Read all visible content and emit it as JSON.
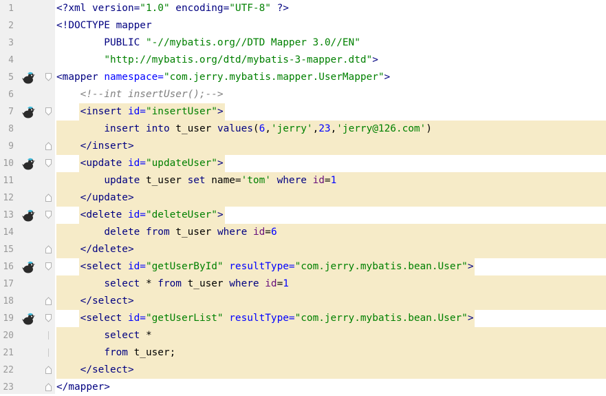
{
  "editor": {
    "lines": [
      {
        "n": "1",
        "tokens": [
          {
            "t": "<?xml version=",
            "c": "t-prolog"
          },
          {
            "t": "\"1.0\"",
            "c": "t-str"
          },
          {
            "t": " encoding=",
            "c": "t-prolog"
          },
          {
            "t": "\"UTF-8\"",
            "c": "t-str"
          },
          {
            "t": " ?>",
            "c": "t-prolog"
          }
        ]
      },
      {
        "n": "2",
        "tokens": [
          {
            "t": "<!DOCTYPE mapper",
            "c": "t-tag"
          }
        ]
      },
      {
        "n": "3",
        "tokens": [
          {
            "t": "        PUBLIC ",
            "c": "t-tag"
          },
          {
            "t": "\"-//mybatis.org//DTD Mapper 3.0//EN\"",
            "c": "t-str"
          }
        ]
      },
      {
        "n": "4",
        "tokens": [
          {
            "t": "        ",
            "c": "t-plain"
          },
          {
            "t": "\"http://mybatis.org/dtd/mybatis-3-mapper.dtd\"",
            "c": "t-str"
          },
          {
            "t": ">",
            "c": "t-tag"
          }
        ]
      },
      {
        "n": "5",
        "icon": true,
        "fold": "open",
        "tokens": [
          {
            "t": "<mapper ",
            "c": "t-tag"
          },
          {
            "t": "namespace=",
            "c": "t-attr"
          },
          {
            "t": "\"com.jerry.mybatis.mapper.UserMapper\"",
            "c": "t-str"
          },
          {
            "t": ">",
            "c": "t-tag"
          }
        ]
      },
      {
        "n": "6",
        "tokens": [
          {
            "t": "    ",
            "c": "t-plain"
          },
          {
            "t": "<!--int insertUser();-->",
            "c": "t-comment"
          }
        ]
      },
      {
        "n": "7",
        "icon": true,
        "fold": "open",
        "hl": "tag",
        "tokens": [
          {
            "t": "    ",
            "c": "t-plain"
          },
          {
            "t": "<insert ",
            "c": "t-tag"
          },
          {
            "t": "id=",
            "c": "t-attr"
          },
          {
            "t": "\"insertUser\"",
            "c": "t-str"
          },
          {
            "t": ">",
            "c": "t-tag"
          }
        ]
      },
      {
        "n": "8",
        "hl": "full",
        "tokens": [
          {
            "t": "        ",
            "c": "t-plain"
          },
          {
            "t": "insert into",
            "c": "t-kw"
          },
          {
            "t": " t_user ",
            "c": "t-plain"
          },
          {
            "t": "values",
            "c": "t-kw"
          },
          {
            "t": "(",
            "c": "t-plain"
          },
          {
            "t": "6",
            "c": "t-num"
          },
          {
            "t": ",",
            "c": "t-plain"
          },
          {
            "t": "'jerry'",
            "c": "t-sql-str"
          },
          {
            "t": ",",
            "c": "t-plain"
          },
          {
            "t": "23",
            "c": "t-num"
          },
          {
            "t": ",",
            "c": "t-plain"
          },
          {
            "t": "'jerry@126.com'",
            "c": "t-sql-str"
          },
          {
            "t": ")",
            "c": "t-plain"
          }
        ]
      },
      {
        "n": "9",
        "fold": "close",
        "hl": "full",
        "tokens": [
          {
            "t": "    ",
            "c": "t-plain"
          },
          {
            "t": "</insert>",
            "c": "t-tag"
          }
        ]
      },
      {
        "n": "10",
        "icon": true,
        "fold": "open",
        "hl": "tag",
        "tokens": [
          {
            "t": "    ",
            "c": "t-plain"
          },
          {
            "t": "<update ",
            "c": "t-tag"
          },
          {
            "t": "id=",
            "c": "t-attr"
          },
          {
            "t": "\"updateUser\"",
            "c": "t-str"
          },
          {
            "t": ">",
            "c": "t-tag"
          }
        ]
      },
      {
        "n": "11",
        "hl": "full",
        "tokens": [
          {
            "t": "        ",
            "c": "t-plain"
          },
          {
            "t": "update",
            "c": "t-kw"
          },
          {
            "t": " t_user ",
            "c": "t-plain"
          },
          {
            "t": "set",
            "c": "t-kw"
          },
          {
            "t": " name=",
            "c": "t-plain"
          },
          {
            "t": "'tom'",
            "c": "t-sql-str"
          },
          {
            "t": " ",
            "c": "t-plain"
          },
          {
            "t": "where",
            "c": "t-kw"
          },
          {
            "t": " ",
            "c": "t-plain"
          },
          {
            "t": "id",
            "c": "t-id"
          },
          {
            "t": "=",
            "c": "t-plain"
          },
          {
            "t": "1",
            "c": "t-num"
          }
        ]
      },
      {
        "n": "12",
        "fold": "close",
        "hl": "full",
        "tokens": [
          {
            "t": "    ",
            "c": "t-plain"
          },
          {
            "t": "</update>",
            "c": "t-tag"
          }
        ]
      },
      {
        "n": "13",
        "icon": true,
        "fold": "open",
        "hl": "tag",
        "tokens": [
          {
            "t": "    ",
            "c": "t-plain"
          },
          {
            "t": "<delete ",
            "c": "t-tag"
          },
          {
            "t": "id=",
            "c": "t-attr"
          },
          {
            "t": "\"deleteUser\"",
            "c": "t-str"
          },
          {
            "t": ">",
            "c": "t-tag"
          }
        ]
      },
      {
        "n": "14",
        "hl": "full",
        "tokens": [
          {
            "t": "        ",
            "c": "t-plain"
          },
          {
            "t": "delete from",
            "c": "t-kw"
          },
          {
            "t": " t_user ",
            "c": "t-plain"
          },
          {
            "t": "where",
            "c": "t-kw"
          },
          {
            "t": " ",
            "c": "t-plain"
          },
          {
            "t": "id",
            "c": "t-id"
          },
          {
            "t": "=",
            "c": "t-plain"
          },
          {
            "t": "6",
            "c": "t-num"
          }
        ]
      },
      {
        "n": "15",
        "fold": "close",
        "hl": "full",
        "tokens": [
          {
            "t": "    ",
            "c": "t-plain"
          },
          {
            "t": "</delete>",
            "c": "t-tag"
          }
        ]
      },
      {
        "n": "16",
        "icon": true,
        "fold": "open",
        "hl": "tag",
        "tokens": [
          {
            "t": "    ",
            "c": "t-plain"
          },
          {
            "t": "<select ",
            "c": "t-tag"
          },
          {
            "t": "id=",
            "c": "t-attr"
          },
          {
            "t": "\"getUserById\"",
            "c": "t-str"
          },
          {
            "t": " resultType=",
            "c": "t-attr"
          },
          {
            "t": "\"com.jerry.mybatis.bean.User\"",
            "c": "t-str"
          },
          {
            "t": ">",
            "c": "t-tag"
          }
        ]
      },
      {
        "n": "17",
        "hl": "full",
        "tokens": [
          {
            "t": "        ",
            "c": "t-plain"
          },
          {
            "t": "select",
            "c": "t-kw"
          },
          {
            "t": " * ",
            "c": "t-plain"
          },
          {
            "t": "from",
            "c": "t-kw"
          },
          {
            "t": " t_user ",
            "c": "t-plain"
          },
          {
            "t": "where",
            "c": "t-kw"
          },
          {
            "t": " ",
            "c": "t-plain"
          },
          {
            "t": "id",
            "c": "t-id"
          },
          {
            "t": "=",
            "c": "t-plain"
          },
          {
            "t": "1",
            "c": "t-num"
          }
        ]
      },
      {
        "n": "18",
        "fold": "close",
        "hl": "full",
        "tokens": [
          {
            "t": "    ",
            "c": "t-plain"
          },
          {
            "t": "</select>",
            "c": "t-tag"
          }
        ]
      },
      {
        "n": "19",
        "icon": true,
        "fold": "open",
        "hl": "tag",
        "tokens": [
          {
            "t": "    ",
            "c": "t-plain"
          },
          {
            "t": "<select ",
            "c": "t-tag"
          },
          {
            "t": "id=",
            "c": "t-attr"
          },
          {
            "t": "\"getUserList\"",
            "c": "t-str"
          },
          {
            "t": " resultType=",
            "c": "t-attr"
          },
          {
            "t": "\"com.jerry.mybatis.bean.User\"",
            "c": "t-str"
          },
          {
            "t": ">",
            "c": "t-tag"
          }
        ]
      },
      {
        "n": "20",
        "fold": "mid",
        "hl": "full",
        "tokens": [
          {
            "t": "        ",
            "c": "t-plain"
          },
          {
            "t": "select",
            "c": "t-kw"
          },
          {
            "t": " *",
            "c": "t-plain"
          }
        ]
      },
      {
        "n": "21",
        "fold": "mid",
        "hl": "full",
        "tokens": [
          {
            "t": "        ",
            "c": "t-plain"
          },
          {
            "t": "from",
            "c": "t-kw"
          },
          {
            "t": " t_user;",
            "c": "t-plain"
          }
        ]
      },
      {
        "n": "22",
        "fold": "close",
        "hl": "full",
        "tokens": [
          {
            "t": "    ",
            "c": "t-plain"
          },
          {
            "t": "</select>",
            "c": "t-tag"
          }
        ]
      },
      {
        "n": "23",
        "fold": "close",
        "tokens": [
          {
            "t": "</mapper>",
            "c": "t-tag"
          }
        ]
      }
    ]
  },
  "icons": {
    "gutter_icon": "mybatis-bird-icon",
    "fold": "fold-marker-icon"
  },
  "colors": {
    "gutter_bg": "#f0f0f0",
    "highlight_bg": "#f6ebc8",
    "tag": "#000080",
    "attr": "#0000ff",
    "string": "#008000",
    "comment": "#808080",
    "line_number": "#999999"
  }
}
